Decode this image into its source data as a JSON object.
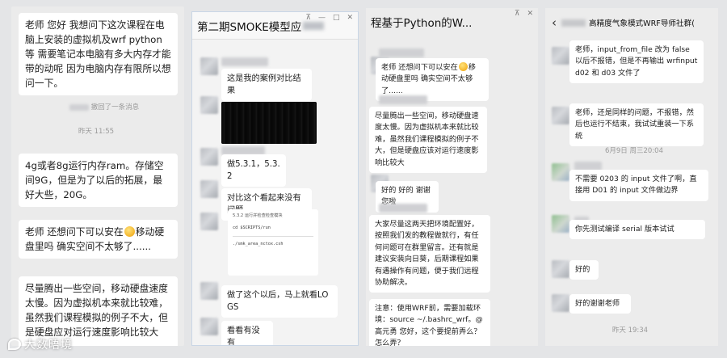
{
  "panel1": {
    "bubble1": "老师 您好 我想问下这次课程在电脑上安装的虚拟机及wrf python等 需要笔记本电脑有多大内存才能带的动呢 因为电脑内存有限所以想问一下。",
    "recall": "撤回了一条消息",
    "time": "昨天 11:55",
    "bubble2": "4g或者8g运行内存ram。存储空间9G，但是为了以后的拓展，最好大些，20G。",
    "bubble3_a": "老师 还想问下可以安在",
    "bubble3_b": "移动硬盘里吗 确实空间不太够了......",
    "bubble4": "尽量腾出一些空间，移动硬盘速度太慢。因为虚拟机本来就比较难，虽然我们课程模拟的例子不大，但是硬盘应对运行速度影响比较大"
  },
  "panel2": {
    "title": "第二期SMOKE模型应",
    "win_pin": "⊼",
    "win_min": "—",
    "win_max": "□",
    "win_close": "✕",
    "msg1": "这是我的案例对比结果",
    "msg2": "做5.3.1，5.3.2",
    "msg3": "对比这个看起来没有问题",
    "code_header": "5.3.2    运行并检查检查模块",
    "code_cmd1": "cd  $SCRIPTS/run",
    "code_cmd2": "./smk_area_nctox.csh",
    "msg4": "做了这个以后，马上就看LOGS",
    "msg5": "看看有没有"
  },
  "panel3": {
    "title": "程基于Python的W...",
    "win_pin": "⊼",
    "win_close": "✕",
    "msg1_a": "老师 还想问下可以安在",
    "msg1_b": "移动硬盘里吗 确实空间不太够了......",
    "msg2": "尽量腾出一些空间，移动硬盘速度太慢。因为虚拟机本来就比较难，虽然我们课程模拟的例子不大，但是硬盘应该对运行速度影响比较大",
    "msg3": "好的 好的 谢谢您啦",
    "msg4": "大家尽量这两天把环境配置好，按照我们发的教程做就行，有任何问题可在群里留言。还有就是建议安装向日葵，后期课程如果有遇操作有问题，便于我们远程协助解决。",
    "msg5": "注意：使用WRF前，需要加载环境：source ~/.bashrc_wrf。@高元勇 您好，这个要提前弄么？怎么弄？"
  },
  "panel4": {
    "back": "‹",
    "title": "高精度气象模式WRF导师社群(",
    "msg1": "老师，input_from_file 改为 false 以后不报错，但是不再输出 wrfinputd02 和 d03 文件了",
    "msg2": "老师，还是同样的问题，不报错，然后也运行不结束，我试试重装一下系统",
    "time1": "6月9日 周三20:04",
    "msg3": "不需要 0203 的 input 文件了啊，直接用 D01 的 input 文件做边界",
    "msg4": "你先测试编译 serial 版本试试",
    "msg5": "好的",
    "msg6": "好的谢谢老师",
    "time2": "昨天 19:34"
  },
  "watermark": {
    "text": "大数晤境"
  },
  "colors": {
    "background": "#e4e5e7",
    "bubble": "#ffffff",
    "system_text": "#9a9a9a",
    "window_border": "#c9d6e6",
    "emoji": "#f4b52b"
  },
  "icons": [
    "back-chevron-icon",
    "pin-icon",
    "minimize-icon",
    "maximize-icon",
    "close-icon",
    "emoji-sweat-icon",
    "watermark-logo-icon"
  ]
}
